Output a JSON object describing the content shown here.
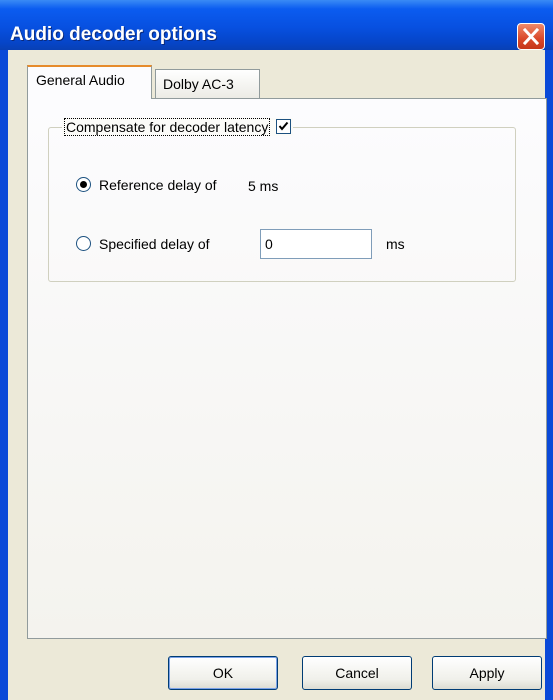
{
  "window": {
    "title": "Audio decoder options",
    "close_icon": "close-icon"
  },
  "tabs": [
    {
      "label": "General Audio",
      "active": true
    },
    {
      "label": "Dolby AC-3",
      "active": false
    }
  ],
  "general_audio": {
    "compensate_label": "Compensate for decoder latency",
    "compensate_checked": true,
    "reference_delay_label": "Reference delay of",
    "reference_delay_value": "5 ms",
    "reference_selected": true,
    "specified_delay_label": "Specified delay of",
    "specified_delay_value": "0",
    "specified_delay_unit": "ms",
    "specified_selected": false
  },
  "buttons": {
    "ok": "OK",
    "cancel": "Cancel",
    "apply": "Apply"
  },
  "colors": {
    "titlebar": "#0750e0",
    "dialog_bg": "#ece9d8",
    "active_tab_accent": "#e68b2c",
    "close_button": "#d9482a"
  }
}
